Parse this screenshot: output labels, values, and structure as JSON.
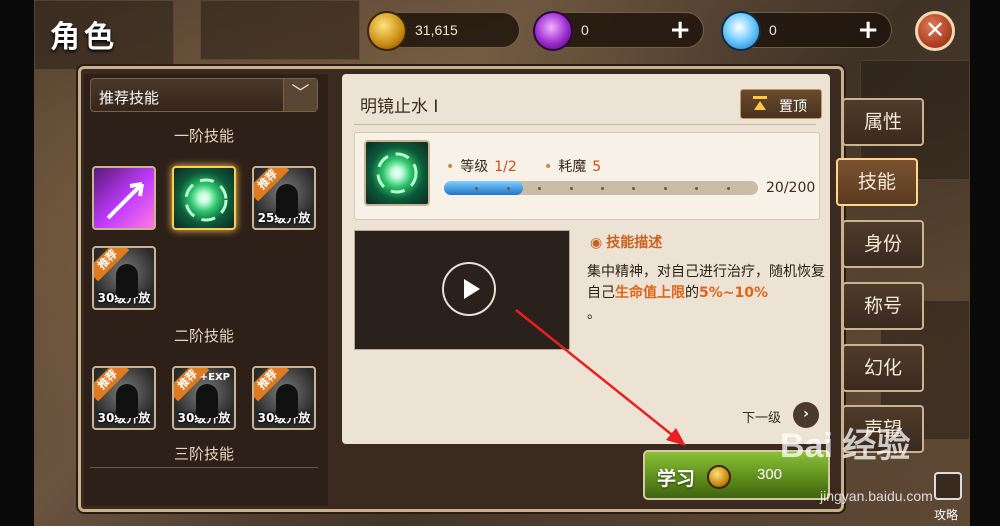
{
  "window": {
    "title": "角色"
  },
  "currencies": [
    {
      "icon": "gold-coin-icon",
      "value": "31,615",
      "has_plus": false
    },
    {
      "icon": "purple-gem-icon",
      "value": "0",
      "has_plus": true
    },
    {
      "icon": "diamond-icon",
      "value": "0",
      "has_plus": true
    }
  ],
  "close_label": "✕",
  "left_panel": {
    "filter": {
      "selected": "推荐技能",
      "chevron": "﹀"
    },
    "tiers": [
      {
        "label": "一阶技能"
      },
      {
        "label": "二阶技能"
      },
      {
        "label": "三阶技能"
      }
    ],
    "tier1_skills": [
      {
        "icon": "arrow-skill-icon",
        "badge": "",
        "lock": "",
        "selected": false
      },
      {
        "icon": "vortex-skill-icon",
        "badge": "",
        "lock": "",
        "selected": true
      },
      {
        "icon": "locked-skill-icon",
        "badge": "推荐",
        "lock": "25级开放",
        "selected": false
      },
      {
        "icon": "locked-skill-icon",
        "badge": "推荐",
        "lock": "30级开放",
        "selected": false
      }
    ],
    "tier2_skills": [
      {
        "icon": "locked-skill-icon",
        "badge": "推荐",
        "lock": "30级开放"
      },
      {
        "icon": "locked-skill-icon",
        "badge": "推荐",
        "extra": "+EXP",
        "lock": "30级开放"
      },
      {
        "icon": "locked-skill-icon",
        "badge": "推荐",
        "lock": "30级开放"
      }
    ]
  },
  "detail": {
    "skill_name": "明镜止水 Ⅰ",
    "pin_label": "置顶",
    "level_label": "等级",
    "level_value": "1/2",
    "mana_label": "耗魔",
    "mana_value": "5",
    "progress": {
      "current": 20,
      "max": 200,
      "text": "20/200"
    },
    "desc_title": "技能描述",
    "desc_parts": [
      "集中精神，对自己进行治疗，随机恢复自己",
      "生命值上限",
      "的",
      "5%~10%",
      "。"
    ],
    "next_label": "下一级",
    "next_arrow": "›"
  },
  "tabs": [
    {
      "label": "属性",
      "active": false
    },
    {
      "label": "技能",
      "active": true
    },
    {
      "label": "身份",
      "active": false
    },
    {
      "label": "称号",
      "active": false
    },
    {
      "label": "幻化",
      "active": false
    },
    {
      "label": "声望",
      "active": false
    }
  ],
  "learn": {
    "label": "学习",
    "cost": "300"
  },
  "guide_label": "攻略",
  "watermark": {
    "logo": "Bai 经验",
    "url": "jingyan.baidu.com"
  },
  "colors": {
    "accent_orange": "#e0651a",
    "learn_green": "#6a9a22",
    "arrow_red": "#e82020"
  }
}
